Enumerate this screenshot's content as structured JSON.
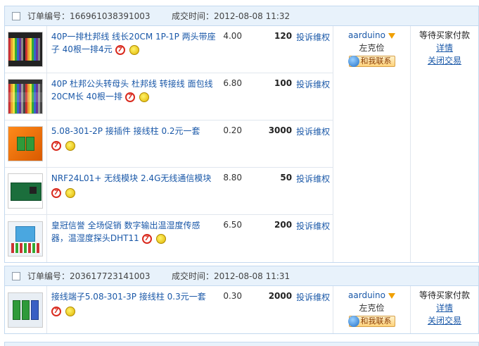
{
  "orders": [
    {
      "order_no_label": "订单编号：",
      "order_no": "166961038391003",
      "deal_time_label": "成交时间：",
      "deal_time": "2012-08-08 11:32",
      "seller": {
        "name": "aarduino",
        "real_name": "左克俭",
        "chat_label": "和我联系"
      },
      "status": {
        "text": "等待买家付款",
        "detail_link": "详情",
        "close_link": "关闭交易"
      },
      "items": [
        {
          "title": "40P一排杜邦线 线长20CM 1P-1P 两头带座子 40根一排4元",
          "price": "4.00",
          "qty": "120",
          "complain": "投诉维权",
          "thumb": "dupont-cable-rainbow"
        },
        {
          "title": "40P 杜邦公头转母头 杜邦线 转接线 面包线 20CM长 40根一排",
          "price": "6.80",
          "qty": "100",
          "complain": "投诉维权",
          "thumb": "dupont-male-female"
        },
        {
          "title": "5.08-301-2P 接插件 接线柱 0.2元一套",
          "price": "0.20",
          "qty": "3000",
          "complain": "投诉维权",
          "thumb": "terminal-block-green"
        },
        {
          "title": "NRF24L01+ 无线模块 2.4G无线通信模块",
          "price": "8.80",
          "qty": "50",
          "complain": "投诉维权",
          "thumb": "nrf-module-pcb"
        },
        {
          "title": "皇冠信誉 全场促销 数字输出温湿度传感器，温湿度探头DHT11",
          "price": "6.50",
          "qty": "200",
          "complain": "投诉维权",
          "thumb": "dht11-sensor"
        }
      ]
    },
    {
      "order_no_label": "订单编号：",
      "order_no": "203617723141003",
      "deal_time_label": "成交时间：",
      "deal_time": "2012-08-08 11:31",
      "seller": {
        "name": "aarduino",
        "real_name": "左克俭",
        "chat_label": "和我联系"
      },
      "status": {
        "text": "等待买家付款",
        "detail_link": "详情",
        "close_link": "关闭交易"
      },
      "items": [
        {
          "title": "接线端子5.08-301-3P 接线柱 0.3元一套",
          "price": "0.30",
          "qty": "2000",
          "complain": "投诉维权",
          "thumb": "terminal-block-3p"
        }
      ]
    }
  ],
  "colors": {
    "link": "#1a58a8",
    "header_bg": "#e8f2fb",
    "border": "#c4d9ef"
  }
}
